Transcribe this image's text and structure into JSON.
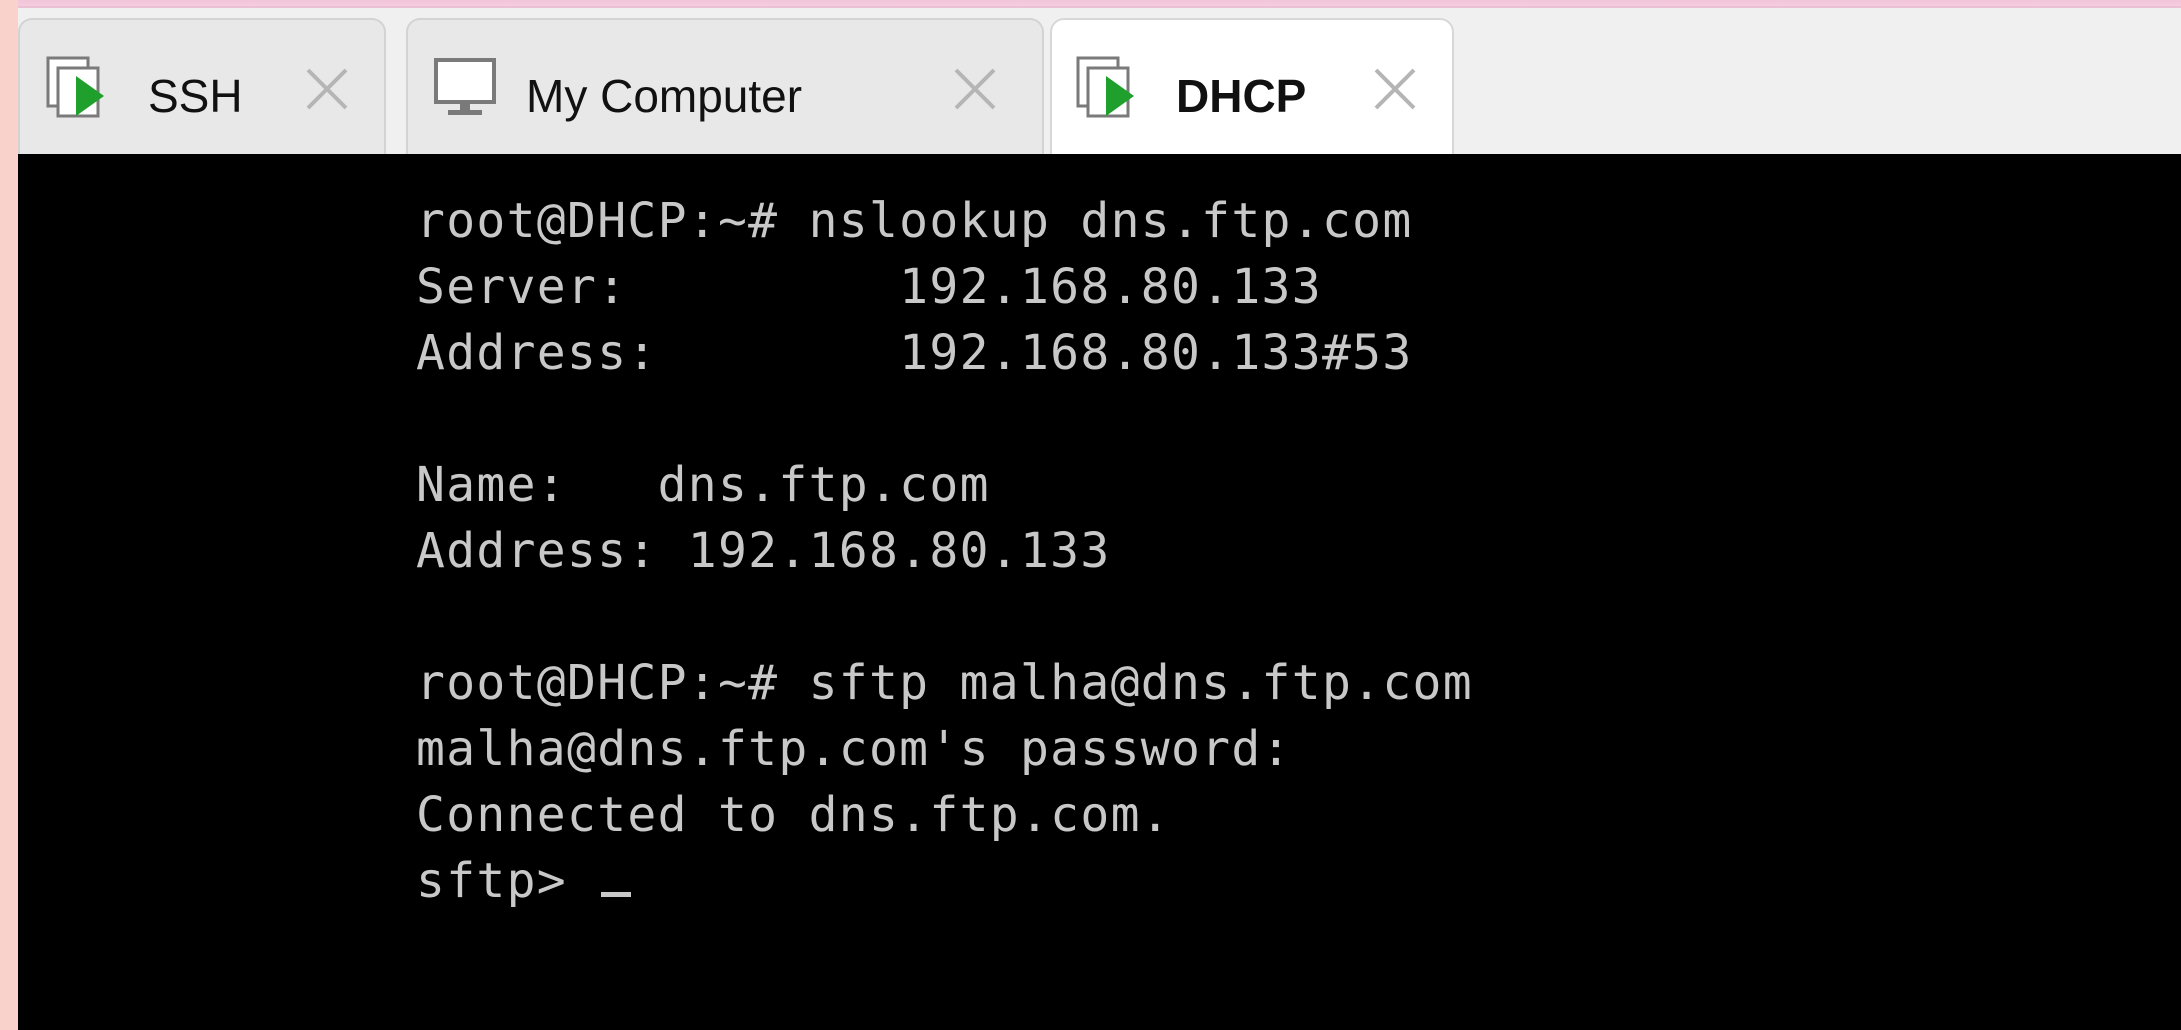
{
  "tabs": [
    {
      "label": "SSH",
      "icon": "terminal-play-icon",
      "active": false
    },
    {
      "label": "My Computer",
      "icon": "monitor-icon",
      "active": false
    },
    {
      "label": "DHCP",
      "icon": "terminal-play-icon",
      "active": true
    }
  ],
  "terminal": {
    "lines": [
      "root@DHCP:~# nslookup dns.ftp.com",
      "Server:         192.168.80.133",
      "Address:        192.168.80.133#53",
      "",
      "Name:   dns.ftp.com",
      "Address: 192.168.80.133",
      "",
      "root@DHCP:~# sftp malha@dns.ftp.com",
      "malha@dns.ftp.com's password:",
      "Connected to dns.ftp.com.",
      "sftp> "
    ]
  },
  "colors": {
    "terminal_bg": "#000000",
    "terminal_fg": "#c8c8c8",
    "play_green": "#1fa02c",
    "tab_active_bg": "#ffffff",
    "tab_inactive_bg": "#e8e8e8"
  }
}
